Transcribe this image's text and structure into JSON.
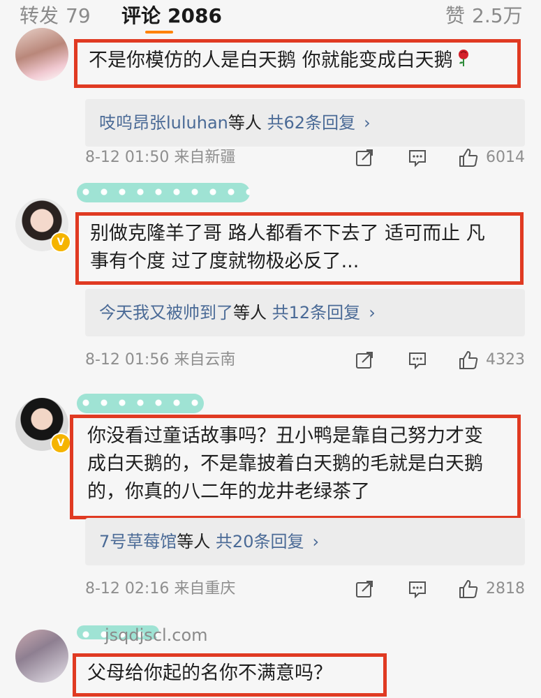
{
  "tabs": {
    "repost_label": "转发",
    "repost_count": "79",
    "comment_label": "评论",
    "comment_count": "2086",
    "like_label": "赞",
    "like_count": "2.5万"
  },
  "comments": [
    {
      "text": "不是你模仿的人是白天鹅 你就能变成白天鹅",
      "reply_users": "吱呜昂张luluhan",
      "reply_suffix": "等人",
      "reply_total": "共62条回复",
      "time": "8-12 01:50",
      "location": "来自新疆",
      "likes": "6014"
    },
    {
      "text_line1": "别做克隆羊了哥 路人都看不下去了 适可而止 凡",
      "text_line2": "事有个度 过了度就物极必反了...",
      "reply_users": "今天我又被帅到了",
      "reply_suffix": "等人",
      "reply_total": "共12条回复",
      "time": "8-12 01:56",
      "location": "来自云南",
      "likes": "4323"
    },
    {
      "text_line1": "你没看过童话故事吗？丑小鸭是靠自己努力才变",
      "text_line2": "成白天鹅的，不是靠披着白天鹅的毛就是白天鹅",
      "text_line3": "的，你真的八二年的龙井老绿茶了",
      "reply_users": "7号草莓馆",
      "reply_suffix": "等人",
      "reply_total": "共20条回复",
      "time": "8-12 02:16",
      "location": "来自重庆",
      "likes": "2818"
    },
    {
      "text": "父母给你起的名你不满意吗？"
    }
  ],
  "watermark": "jsqdjscl.com",
  "icons": {
    "share": "share-icon",
    "comment": "comment-icon",
    "like": "thumbs-up-icon",
    "rose": "rose-icon",
    "verified": "verified-badge-icon"
  },
  "colors": {
    "highlight_box": "#e03a22",
    "link": "#4a6a96",
    "accent": "#ff8200",
    "name_blur": "#9fe3d4"
  }
}
